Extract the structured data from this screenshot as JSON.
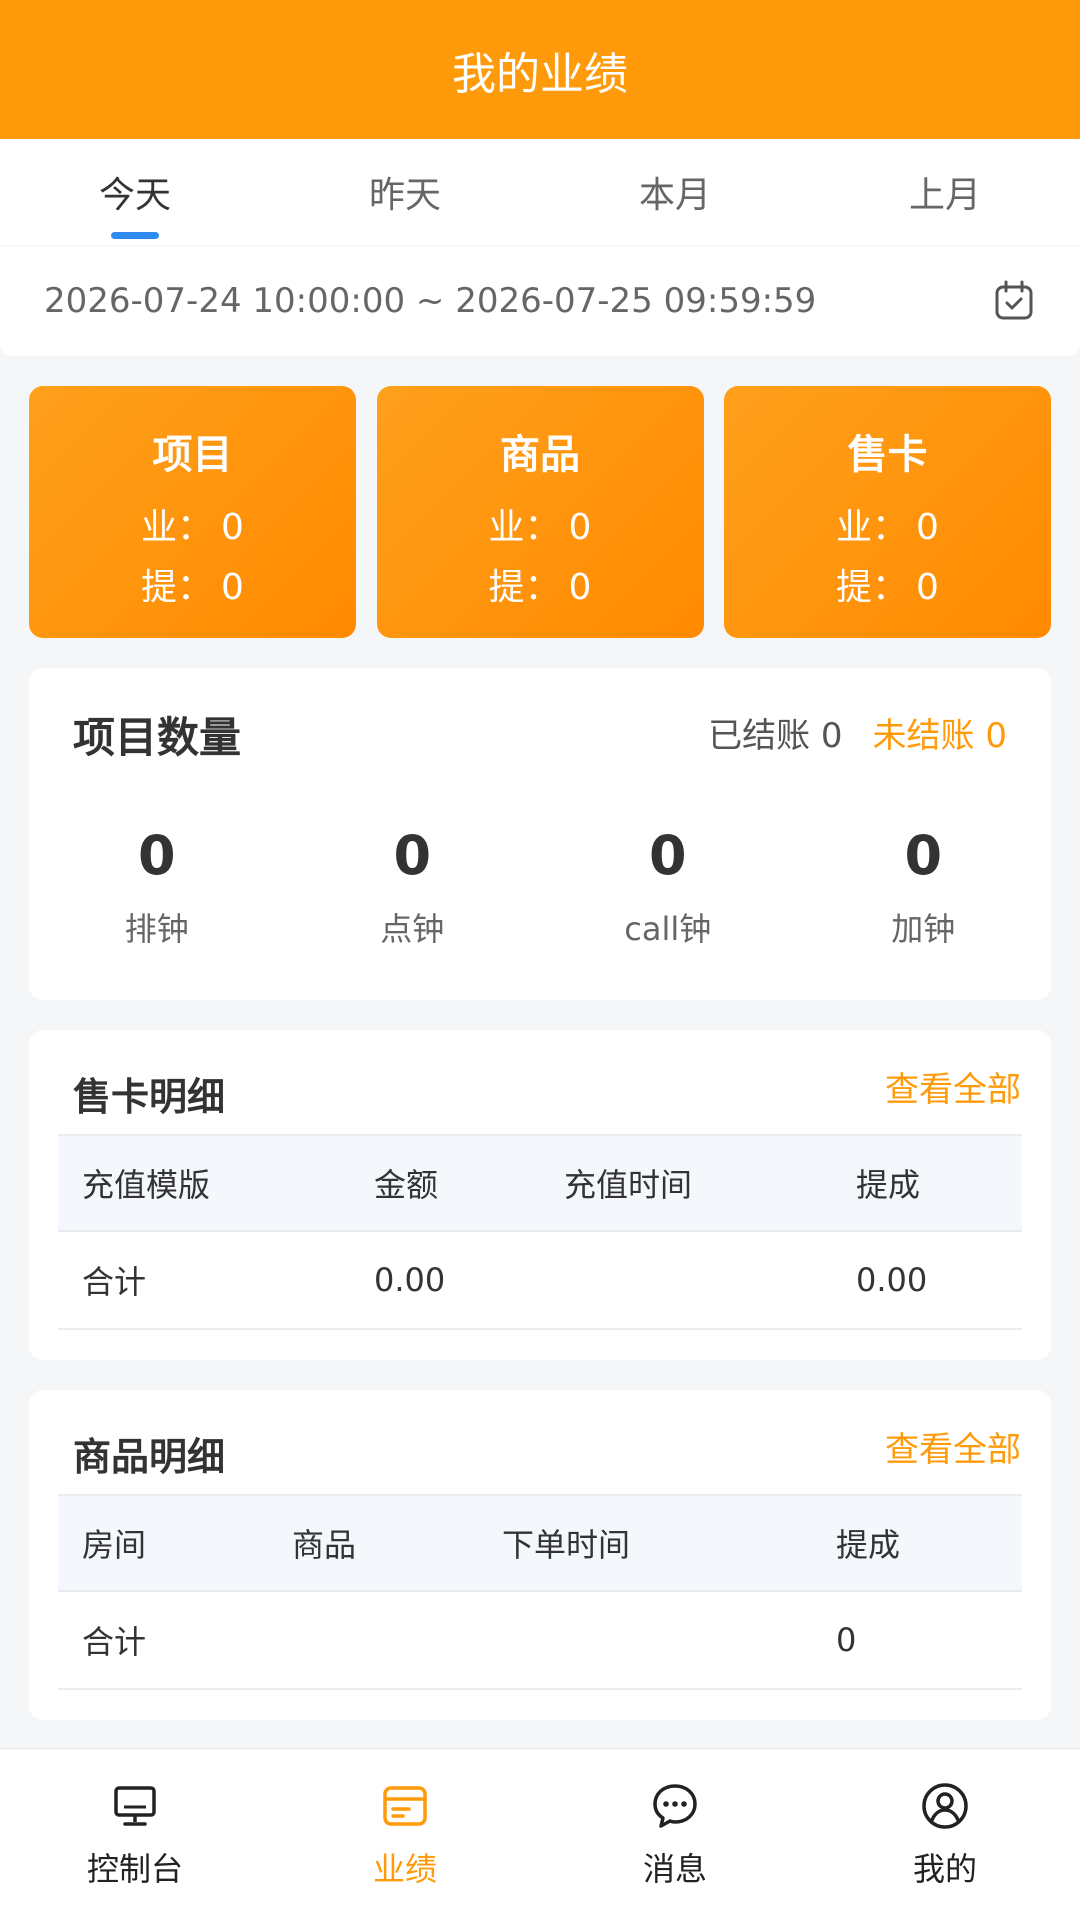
{
  "header": {
    "title": "我的业绩"
  },
  "tabs": [
    {
      "label": "今天",
      "active": true
    },
    {
      "label": "昨天",
      "active": false
    },
    {
      "label": "本月",
      "active": false
    },
    {
      "label": "上月",
      "active": false
    }
  ],
  "date_range": {
    "text": "2026-07-24 10:00:00 ~ 2026-07-25 09:59:59",
    "icon": "calendar-icon"
  },
  "stat_cards": [
    {
      "name": "项目",
      "performance_label": "业：",
      "performance": "0",
      "commission_label": "提：",
      "commission": "0"
    },
    {
      "name": "商品",
      "performance_label": "业：",
      "performance": "0",
      "commission_label": "提：",
      "commission": "0"
    },
    {
      "name": "售卡",
      "performance_label": "业：",
      "performance": "0",
      "commission_label": "提：",
      "commission": "0"
    }
  ],
  "project_quantity": {
    "title": "项目数量",
    "settled_label": "已结账",
    "settled_value": "0",
    "unsettled_label": "未结账",
    "unsettled_value": "0",
    "items": [
      {
        "value": "0",
        "label": "排钟"
      },
      {
        "value": "0",
        "label": "点钟"
      },
      {
        "value": "0",
        "label": "call钟"
      },
      {
        "value": "0",
        "label": "加钟"
      }
    ]
  },
  "card_detail": {
    "title": "售卡明细",
    "view_all": "查看全部",
    "columns": [
      "充值模版",
      "金额",
      "充值时间",
      "提成"
    ],
    "total_row": [
      "合计",
      "0.00",
      "",
      "0.00"
    ]
  },
  "goods_detail": {
    "title": "商品明细",
    "view_all": "查看全部",
    "columns": [
      "房间",
      "商品",
      "下单时间",
      "提成"
    ],
    "total_row": [
      "合计",
      "",
      "",
      "0"
    ]
  },
  "tabbar": [
    {
      "label": "控制台",
      "icon": "monitor-icon",
      "active": false
    },
    {
      "label": "业绩",
      "icon": "wallet-card-icon",
      "active": true
    },
    {
      "label": "消息",
      "icon": "chat-bubble-icon",
      "active": false
    },
    {
      "label": "我的",
      "icon": "user-circle-icon",
      "active": false
    }
  ],
  "colors": {
    "primary": "#ff9a0a",
    "tab_indicator": "#2e8cf0",
    "background": "#f5f6f8"
  }
}
